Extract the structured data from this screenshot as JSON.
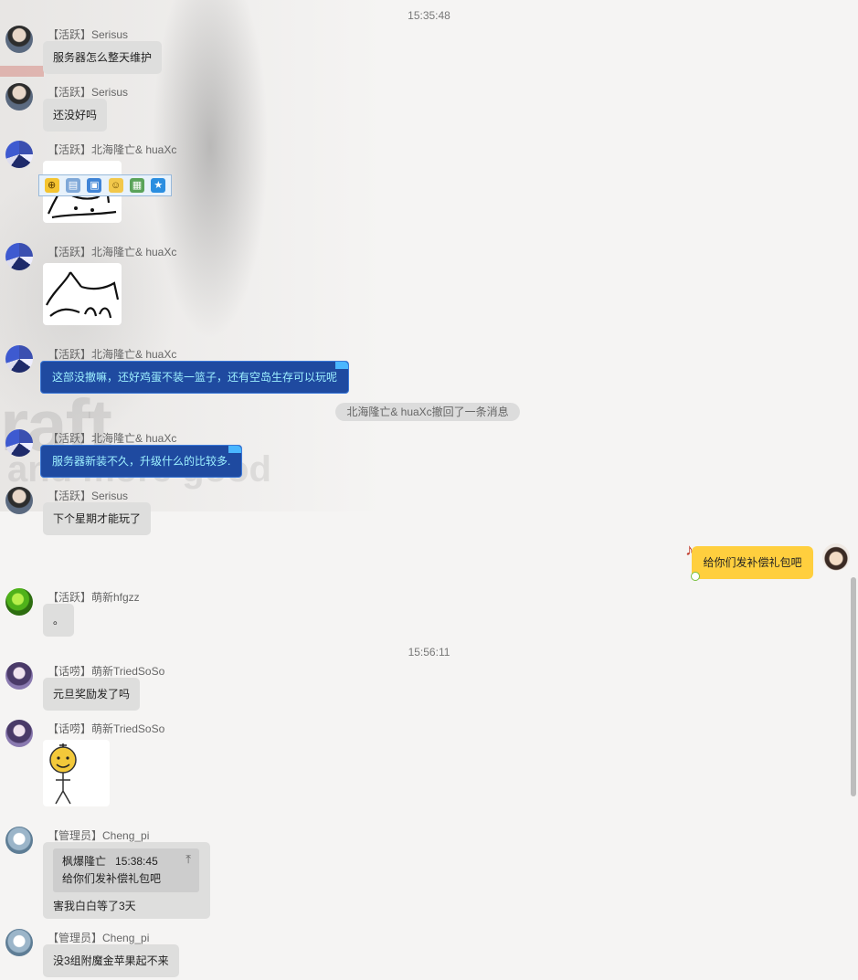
{
  "colors": {
    "background": "#f5f4f3",
    "bubble": "#dededd",
    "blue_bubble": "#1f4aa0",
    "blue_text": "#9df0ff",
    "self_bubble": "#ffcf3e"
  },
  "timestamps": [
    "15:35:48",
    "15:56:11"
  ],
  "messages": [
    {
      "sender": "【活跃】Serisus",
      "text": "服务器怎么整天维护"
    },
    {
      "sender": "【活跃】Serisus",
      "text": "还没好吗"
    },
    {
      "sender": "【活跃】北海隆亡& huaXc",
      "image": "sticker-cat"
    },
    {
      "sender": "【活跃】北海隆亡& huaXc",
      "image": "sticker-cat"
    },
    {
      "sender": "【活跃】北海隆亡& huaXc",
      "text": "这部没撤嘛，还好鸡蛋不装一篮子，还有空岛生存可以玩呢"
    },
    {
      "sender": "【活跃】北海隆亡& huaXc",
      "text": "服务器新装不久，升级什么的比较多."
    },
    {
      "sender": "【活跃】Serisus",
      "text": "下个星期才能玩了"
    },
    {
      "sender": "self",
      "text": "给你们发补偿礼包吧"
    },
    {
      "sender": "【活跃】萌新hfgzz",
      "text": "。"
    },
    {
      "sender": "【话唠】萌新TriedSoSo",
      "text": "元旦奖励发了吗"
    },
    {
      "sender": "【话唠】萌新TriedSoSo",
      "image": "sticker-character"
    },
    {
      "sender": "【管理员】Cheng_pi",
      "quote": {
        "author": "枫爆隆亡",
        "time": "15:38:45",
        "text": "给你们发补偿礼包吧"
      },
      "text": "害我白白等了3天"
    },
    {
      "sender": "【管理员】Cheng_pi",
      "text": "没3组附魔金苹果起不来"
    }
  ],
  "recall_notice": "北海隆亡& huaXc撤回了一条消息",
  "image_toolbar": [
    "zoom-icon",
    "save-icon",
    "screen-icon",
    "emoji-icon",
    "image-icon",
    "bookmark-icon"
  ],
  "background_text": {
    "word1": "raft",
    "word2": "and more good"
  }
}
